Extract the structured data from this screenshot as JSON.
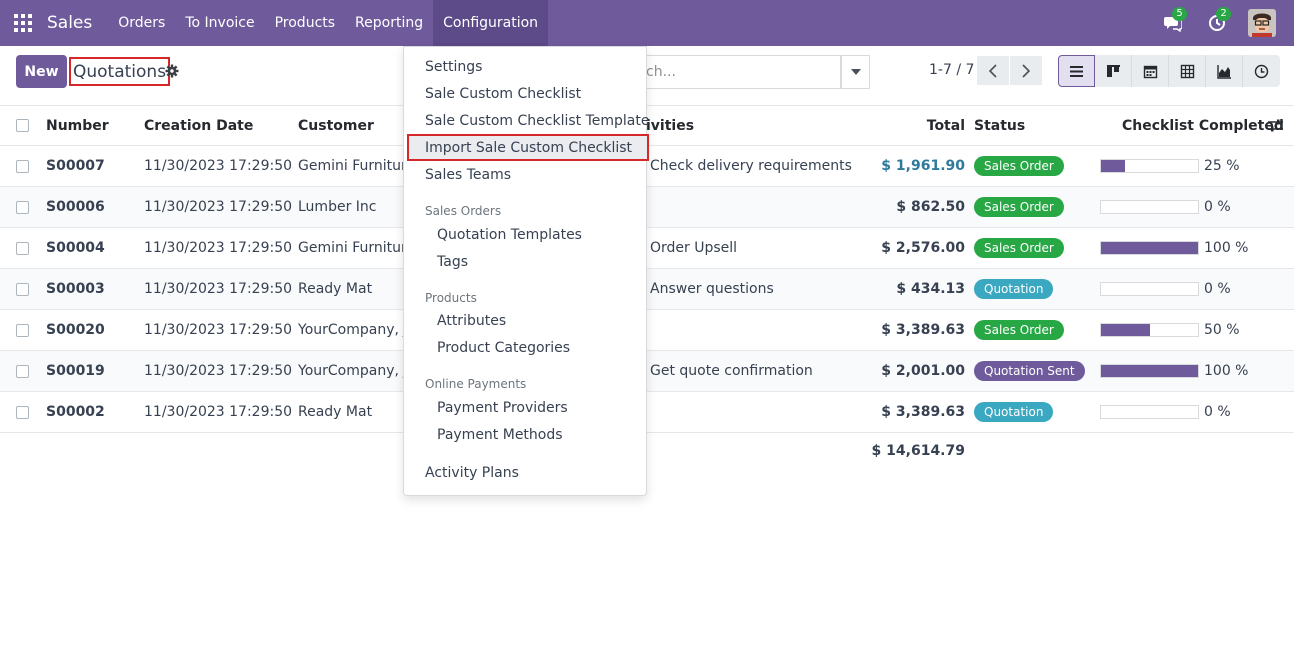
{
  "navbar": {
    "app_name": "Sales",
    "menu": [
      "Orders",
      "To Invoice",
      "Products",
      "Reporting",
      "Configuration"
    ],
    "active_menu": "Configuration",
    "messages_count": "5",
    "activities_count": "2",
    "bar_color": "#6f5b9c"
  },
  "control_panel": {
    "new_label": "New",
    "title": "Quotations",
    "search_visible_text": "ch...",
    "pager": "1-7 / 7",
    "views": [
      "list-view-icon",
      "kanban-view-icon",
      "calendar-view-icon",
      "pivot-view-icon",
      "graph-view-icon",
      "activity-view-icon"
    ],
    "active_view": "list-view-icon"
  },
  "table": {
    "headers": {
      "number": "Number",
      "creation_date": "Creation Date",
      "customer": "Customer",
      "activities": "ivities",
      "total": "Total",
      "status": "Status",
      "checklist": "Checklist Completed"
    },
    "rows": [
      {
        "number": "S00007",
        "date": "11/30/2023 17:29:50",
        "customer": "Gemini Furniture",
        "activity": "Check delivery requirements",
        "total": "$ 1,961.90",
        "total_link": true,
        "status": "Sales Order",
        "status_color": "#28a745",
        "progress": 25,
        "progress_label": "25 %"
      },
      {
        "number": "S00006",
        "date": "11/30/2023 17:29:50",
        "customer": "Lumber Inc",
        "activity": "",
        "total": "$ 862.50",
        "total_link": false,
        "status": "Sales Order",
        "status_color": "#28a745",
        "progress": 0,
        "progress_label": "0 %"
      },
      {
        "number": "S00004",
        "date": "11/30/2023 17:29:50",
        "customer": "Gemini Furniture",
        "activity": "Order Upsell",
        "total": "$ 2,576.00",
        "total_link": false,
        "status": "Sales Order",
        "status_color": "#28a745",
        "progress": 100,
        "progress_label": "100 %"
      },
      {
        "number": "S00003",
        "date": "11/30/2023 17:29:50",
        "customer": "Ready Mat",
        "activity": "Answer questions",
        "total": "$ 434.13",
        "total_link": false,
        "status": "Quotation",
        "status_color": "#3aa8c1",
        "progress": 0,
        "progress_label": "0 %"
      },
      {
        "number": "S00020",
        "date": "11/30/2023 17:29:50",
        "customer": "YourCompany, Jo",
        "activity": "",
        "total": "$ 3,389.63",
        "total_link": false,
        "status": "Sales Order",
        "status_color": "#28a745",
        "progress": 50,
        "progress_label": "50 %"
      },
      {
        "number": "S00019",
        "date": "11/30/2023 17:29:50",
        "customer": "YourCompany, Jo",
        "activity": "Get quote confirmation",
        "total": "$ 2,001.00",
        "total_link": false,
        "status": "Quotation Sent",
        "status_color": "#6f5b9c",
        "progress": 100,
        "progress_label": "100 %"
      },
      {
        "number": "S00002",
        "date": "11/30/2023 17:29:50",
        "customer": "Ready Mat",
        "activity": "",
        "total": "$ 3,389.63",
        "total_link": false,
        "status": "Quotation",
        "status_color": "#3aa8c1",
        "progress": 0,
        "progress_label": "0 %"
      }
    ],
    "grand_total": "$ 14,614.79"
  },
  "config_menu": {
    "settings": "Settings",
    "sale_custom_checklist": "Sale Custom Checklist",
    "sale_custom_checklist_template": "Sale Custom Checklist Template",
    "import_sale_custom_checklist": "Import Sale Custom Checklist",
    "sales_teams": "Sales Teams",
    "sales_orders_header": "Sales Orders",
    "quotation_templates": "Quotation Templates",
    "tags": "Tags",
    "products_header": "Products",
    "attributes": "Attributes",
    "product_categories": "Product Categories",
    "online_payments_header": "Online Payments",
    "payment_providers": "Payment Providers",
    "payment_methods": "Payment Methods",
    "activity_plans": "Activity Plans"
  }
}
